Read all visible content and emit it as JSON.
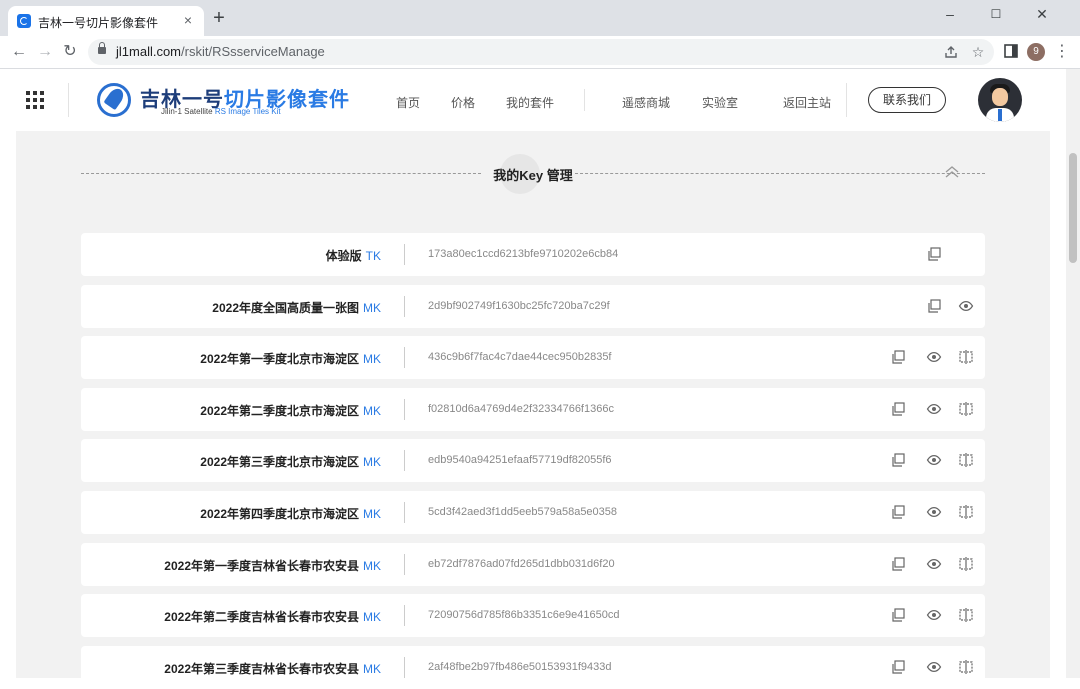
{
  "browser": {
    "tab_title": "吉林一号切片影像套件",
    "tab_close": "×",
    "new_tab": "+",
    "url_host": "jl1mall.com",
    "url_path": "/rskit/RSsserviceManage",
    "profile_initial": "9",
    "controls": {
      "minimize": "–",
      "maximize": "☐",
      "close": "✕"
    },
    "nav": {
      "back": "←",
      "forward": "→",
      "reload": "↻"
    },
    "icons": [
      "lock-icon",
      "share-icon",
      "star-icon",
      "sidebar-icon",
      "profile-icon",
      "menu-icon"
    ]
  },
  "header": {
    "logo_title_main": "吉林一号",
    "logo_title_accent": "切片影像套件",
    "logo_sub_main": "Jilin-1 Satellite ",
    "logo_sub_accent": "RS Image Tiles Kit",
    "nav": [
      "首页",
      "价格",
      "我的套件",
      "遥感商城",
      "实验室",
      "返回主站"
    ],
    "contact_label": "联系我们"
  },
  "section": {
    "title": "我的Key 管理"
  },
  "keys": [
    {
      "name": "体验版",
      "type": "TK",
      "key": "173a80ec1ccd6213bfe9710202e6cb84",
      "actions": [
        "copy-icon"
      ]
    },
    {
      "name": "2022年度全国高质量一张图",
      "type": "MK",
      "key": "2d9bf902749f1630bc25fc720ba7c29f",
      "actions": [
        "copy-icon",
        "eye-icon"
      ]
    },
    {
      "name": "2022年第一季度北京市海淀区",
      "type": "MK",
      "key": "436c9b6f7fac4c7dae44cec950b2835f",
      "actions": [
        "copy-icon",
        "eye-icon",
        "compare-icon"
      ]
    },
    {
      "name": "2022年第二季度北京市海淀区",
      "type": "MK",
      "key": "f02810d6a4769d4e2f32334766f1366c",
      "actions": [
        "copy-icon",
        "eye-icon",
        "compare-icon"
      ]
    },
    {
      "name": "2022年第三季度北京市海淀区",
      "type": "MK",
      "key": "edb9540a94251efaaf57719df82055f6",
      "actions": [
        "copy-icon",
        "eye-icon",
        "compare-icon"
      ]
    },
    {
      "name": "2022年第四季度北京市海淀区",
      "type": "MK",
      "key": "5cd3f42aed3f1dd5eeb579a58a5e0358",
      "actions": [
        "copy-icon",
        "eye-icon",
        "compare-icon"
      ]
    },
    {
      "name": "2022年第一季度吉林省长春市农安县",
      "type": "MK",
      "key": "eb72df7876ad07fd265d1dbb031d6f20",
      "actions": [
        "copy-icon",
        "eye-icon",
        "compare-icon"
      ]
    },
    {
      "name": "2022年第二季度吉林省长春市农安县",
      "type": "MK",
      "key": "72090756d785f86b3351c6e9e41650cd",
      "actions": [
        "copy-icon",
        "eye-icon",
        "compare-icon"
      ]
    },
    {
      "name": "2022年第三季度吉林省长春市农安县",
      "type": "MK",
      "key": "2af48fbe2b97fb486e50153931f9433d",
      "actions": [
        "copy-icon",
        "eye-icon",
        "compare-icon"
      ]
    }
  ]
}
